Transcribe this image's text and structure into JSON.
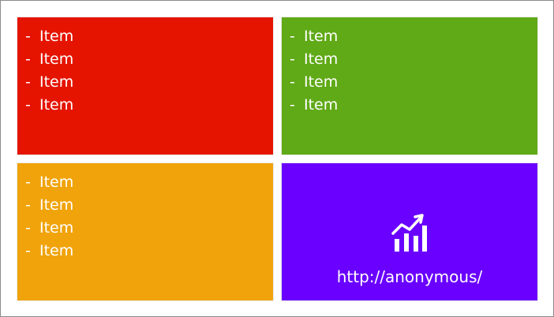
{
  "colors": {
    "tile_top_left": "#e51400",
    "tile_top_right": "#60a917",
    "tile_bottom_left": "#f0a30a",
    "tile_bottom_right": "#6a00ff",
    "text": "#ffffff"
  },
  "tiles": {
    "top_left": {
      "items": [
        "Item",
        "Item",
        "Item",
        "Item"
      ]
    },
    "top_right": {
      "items": [
        "Item",
        "Item",
        "Item",
        "Item"
      ]
    },
    "bottom_left": {
      "items": [
        "Item",
        "Item",
        "Item",
        "Item"
      ]
    },
    "bottom_right": {
      "icon": "bar-chart-trend-icon",
      "url": "http://anonymous/"
    }
  },
  "list_marker": "-"
}
